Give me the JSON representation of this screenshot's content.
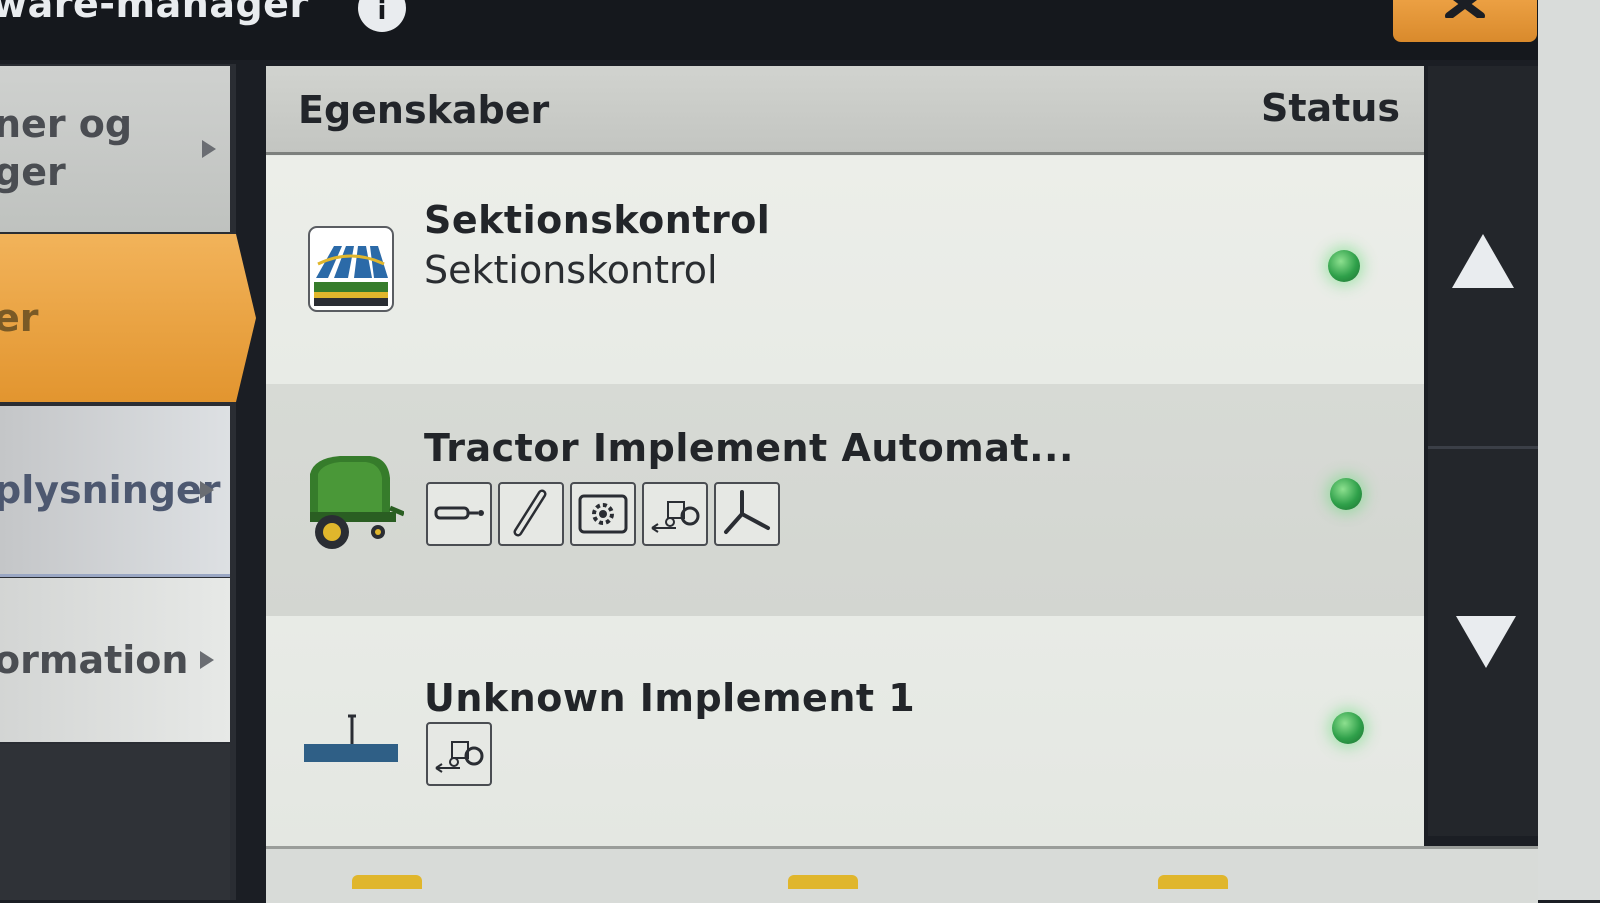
{
  "titlebar": {
    "title": "ware-manager",
    "info_label": "i"
  },
  "sidebar": {
    "items": [
      {
        "label_line1": "ner og",
        "label_line2": "ger"
      },
      {
        "label": "er",
        "selected": true
      },
      {
        "label": "plysninger"
      },
      {
        "label": "ormation"
      }
    ]
  },
  "table": {
    "col_properties": "Egenskaber",
    "col_status": "Status",
    "rows": [
      {
        "name": "Sektionskontrol",
        "subtitle": "Sektionskontrol",
        "icon": "section-control-icon",
        "status": "active"
      },
      {
        "name": "Tractor Implement Automat...",
        "icon": "baler-icon",
        "functions": [
          "hitch-icon",
          "wrench-icon",
          "settings-icon",
          "tractor-implement-icon",
          "steering-icon"
        ],
        "status": "active"
      },
      {
        "name": "Unknown Implement 1",
        "icon": "unknown-implement-icon",
        "functions": [
          "tractor-implement-icon"
        ],
        "status": "active"
      }
    ]
  },
  "colors": {
    "accent": "#E8A03E",
    "status_on": "#3DB356",
    "header_bg": "#C9CBC7",
    "frame": "#1B1E24"
  }
}
